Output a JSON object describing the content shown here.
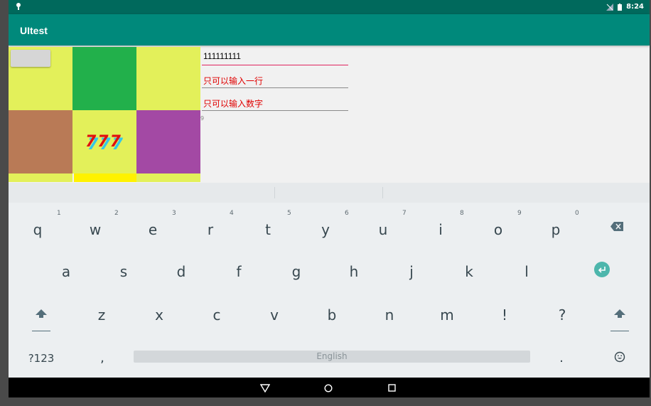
{
  "status_bar": {
    "time": "8:24",
    "signal_icon": "no-sim-icon",
    "battery_icon": "battery-icon",
    "debug_icon": "debug-icon"
  },
  "app": {
    "title": "UItest",
    "colors": {
      "status_bar": "#00695c",
      "app_bar": "#00897b"
    }
  },
  "grid": {
    "cells": [
      {
        "color": "#e3f05a"
      },
      {
        "color": "#22b04b"
      },
      {
        "color": "#e3f05a"
      },
      {
        "color": "#b97a56"
      },
      {
        "color": "#e3f05a"
      },
      {
        "color": "#a349a4"
      }
    ],
    "center_text": "777",
    "button_label": ""
  },
  "fields": [
    {
      "value": "111111111",
      "color": "#000000",
      "underline": "#e0245e"
    },
    {
      "value": "只可以输入一行",
      "color": "#e00000",
      "underline": "#8a8a8a"
    },
    {
      "value": "只可以输入数字",
      "color": "#e00000",
      "underline": "#8a8a8a"
    }
  ],
  "tiny_text": "9",
  "keyboard": {
    "row1": [
      {
        "key": "q",
        "hint": "1"
      },
      {
        "key": "w",
        "hint": "2"
      },
      {
        "key": "e",
        "hint": "3"
      },
      {
        "key": "r",
        "hint": "4"
      },
      {
        "key": "t",
        "hint": "5"
      },
      {
        "key": "y",
        "hint": "6"
      },
      {
        "key": "u",
        "hint": "7"
      },
      {
        "key": "i",
        "hint": "8"
      },
      {
        "key": "o",
        "hint": "9"
      },
      {
        "key": "p",
        "hint": "0"
      }
    ],
    "row2": [
      "a",
      "s",
      "d",
      "f",
      "g",
      "h",
      "j",
      "k",
      "l"
    ],
    "row3": [
      "z",
      "x",
      "c",
      "v",
      "b",
      "n",
      "m",
      "!",
      "?"
    ],
    "symbols_label": "?123",
    "comma": ",",
    "space_label": "English",
    "period": ".",
    "backspace_icon": "backspace-icon",
    "enter_icon": "enter-icon",
    "shift_icon": "shift-icon",
    "emoji_icon": "emoji-icon"
  },
  "nav": {
    "back_icon": "back-icon",
    "home_icon": "home-icon",
    "recents_icon": "recents-icon"
  }
}
